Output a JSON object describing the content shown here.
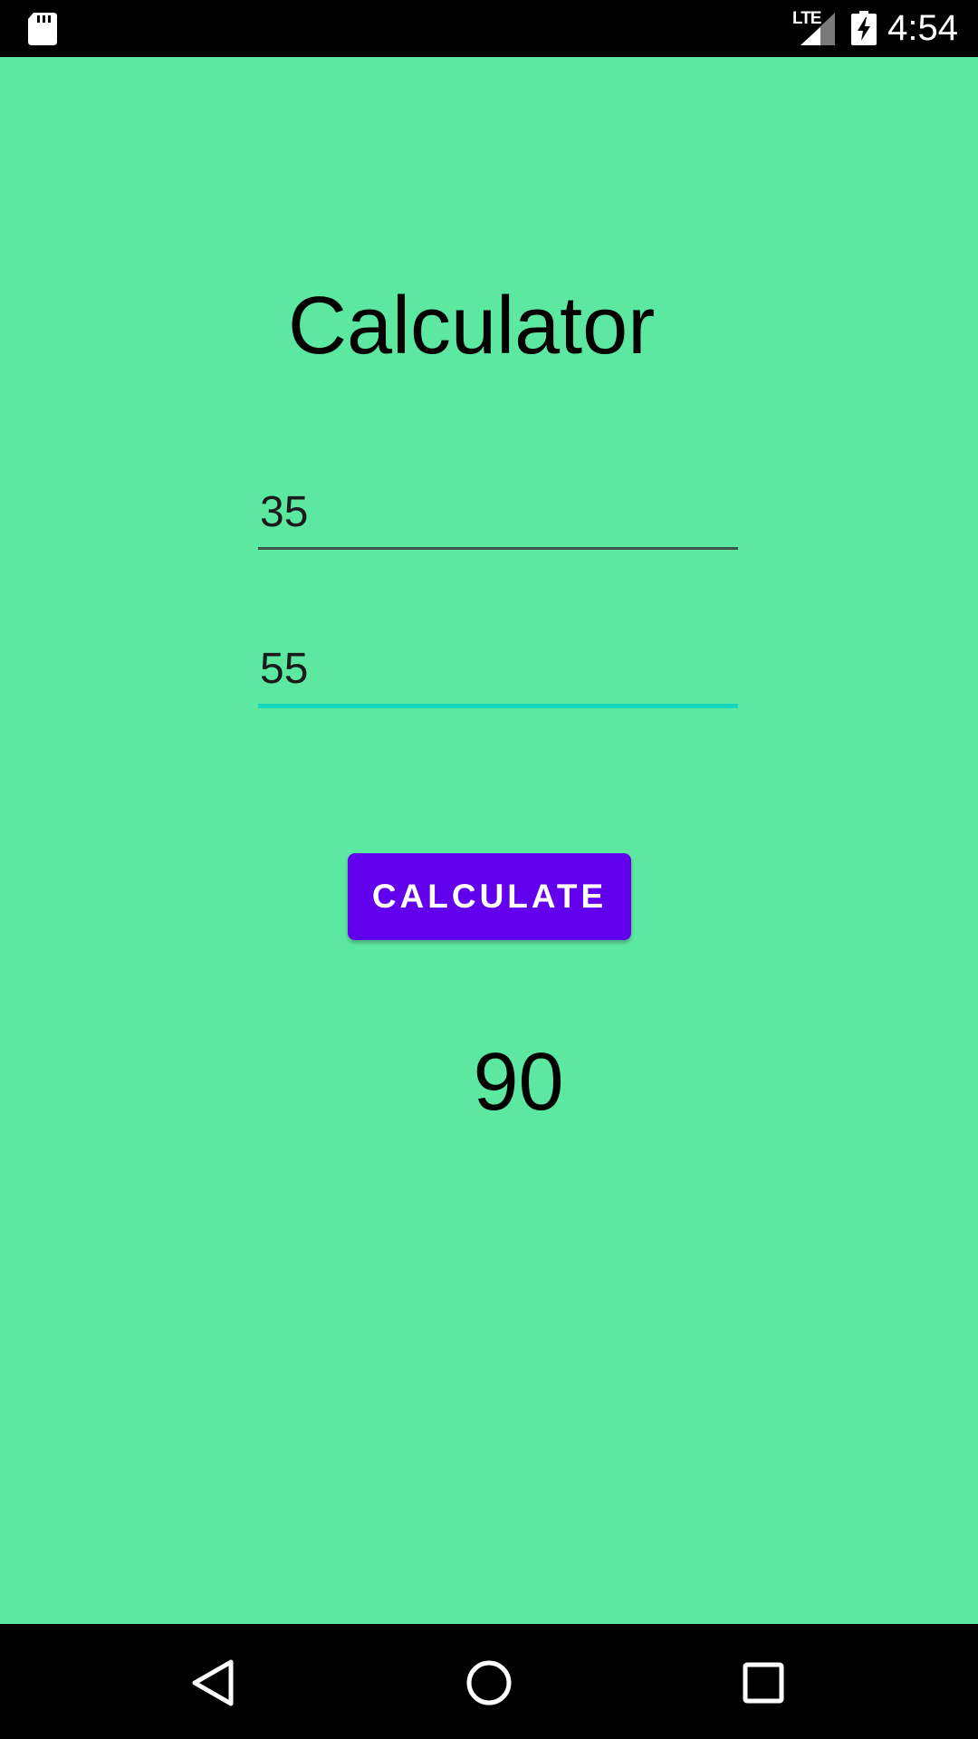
{
  "status_bar": {
    "network_label": "LTE",
    "time": "4:54",
    "icons": [
      "sd-card-icon",
      "lte-signal-icon",
      "battery-charging-icon"
    ]
  },
  "app": {
    "title": "Calculator",
    "background_color": "#5de8a1",
    "first_number": {
      "value": "35"
    },
    "second_number": {
      "value": "55"
    },
    "calculate_button": {
      "label": "CALCULATE",
      "color": "#6200ee"
    },
    "result": "90",
    "focus_accent_color": "#13d8c0"
  },
  "nav_bar": {
    "icons": [
      "back-icon",
      "home-icon",
      "recents-icon"
    ]
  }
}
